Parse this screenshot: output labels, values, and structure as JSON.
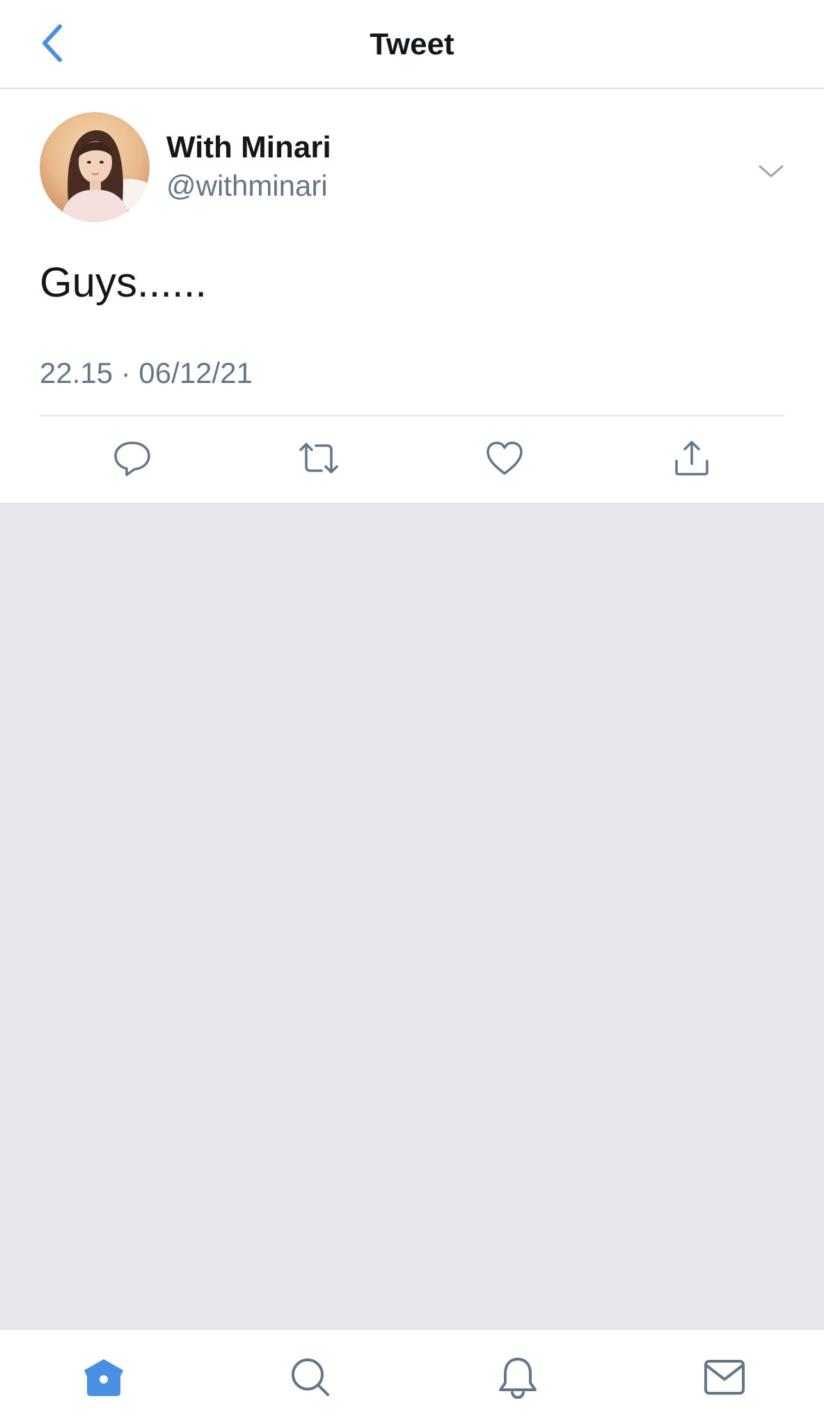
{
  "header": {
    "title": "Tweet",
    "back_icon": "back-chevron-icon"
  },
  "tweet": {
    "author_name": "With Minari",
    "author_handle": "@withminari",
    "avatar_icon": "profile-photo",
    "text": "Guys......",
    "time": "22.15",
    "date": "06/12/21",
    "meta": "22.15 · 06/12/21",
    "actions": [
      {
        "name": "reply",
        "icon": "reply-icon"
      },
      {
        "name": "retweet",
        "icon": "retweet-icon"
      },
      {
        "name": "like",
        "icon": "heart-icon"
      },
      {
        "name": "share",
        "icon": "share-icon"
      }
    ]
  },
  "tabbar": {
    "items": [
      {
        "name": "home",
        "icon": "home-icon",
        "active": true
      },
      {
        "name": "search",
        "icon": "search-icon",
        "active": false
      },
      {
        "name": "notifications",
        "icon": "bell-icon",
        "active": false
      },
      {
        "name": "messages",
        "icon": "mail-icon",
        "active": false
      }
    ]
  },
  "colors": {
    "accent": "#4a90e2",
    "text_primary": "#14171a",
    "text_secondary": "#657786",
    "icon_gray": "#657786",
    "background_empty": "#e6e8ee",
    "divider": "#e1e8ed"
  }
}
